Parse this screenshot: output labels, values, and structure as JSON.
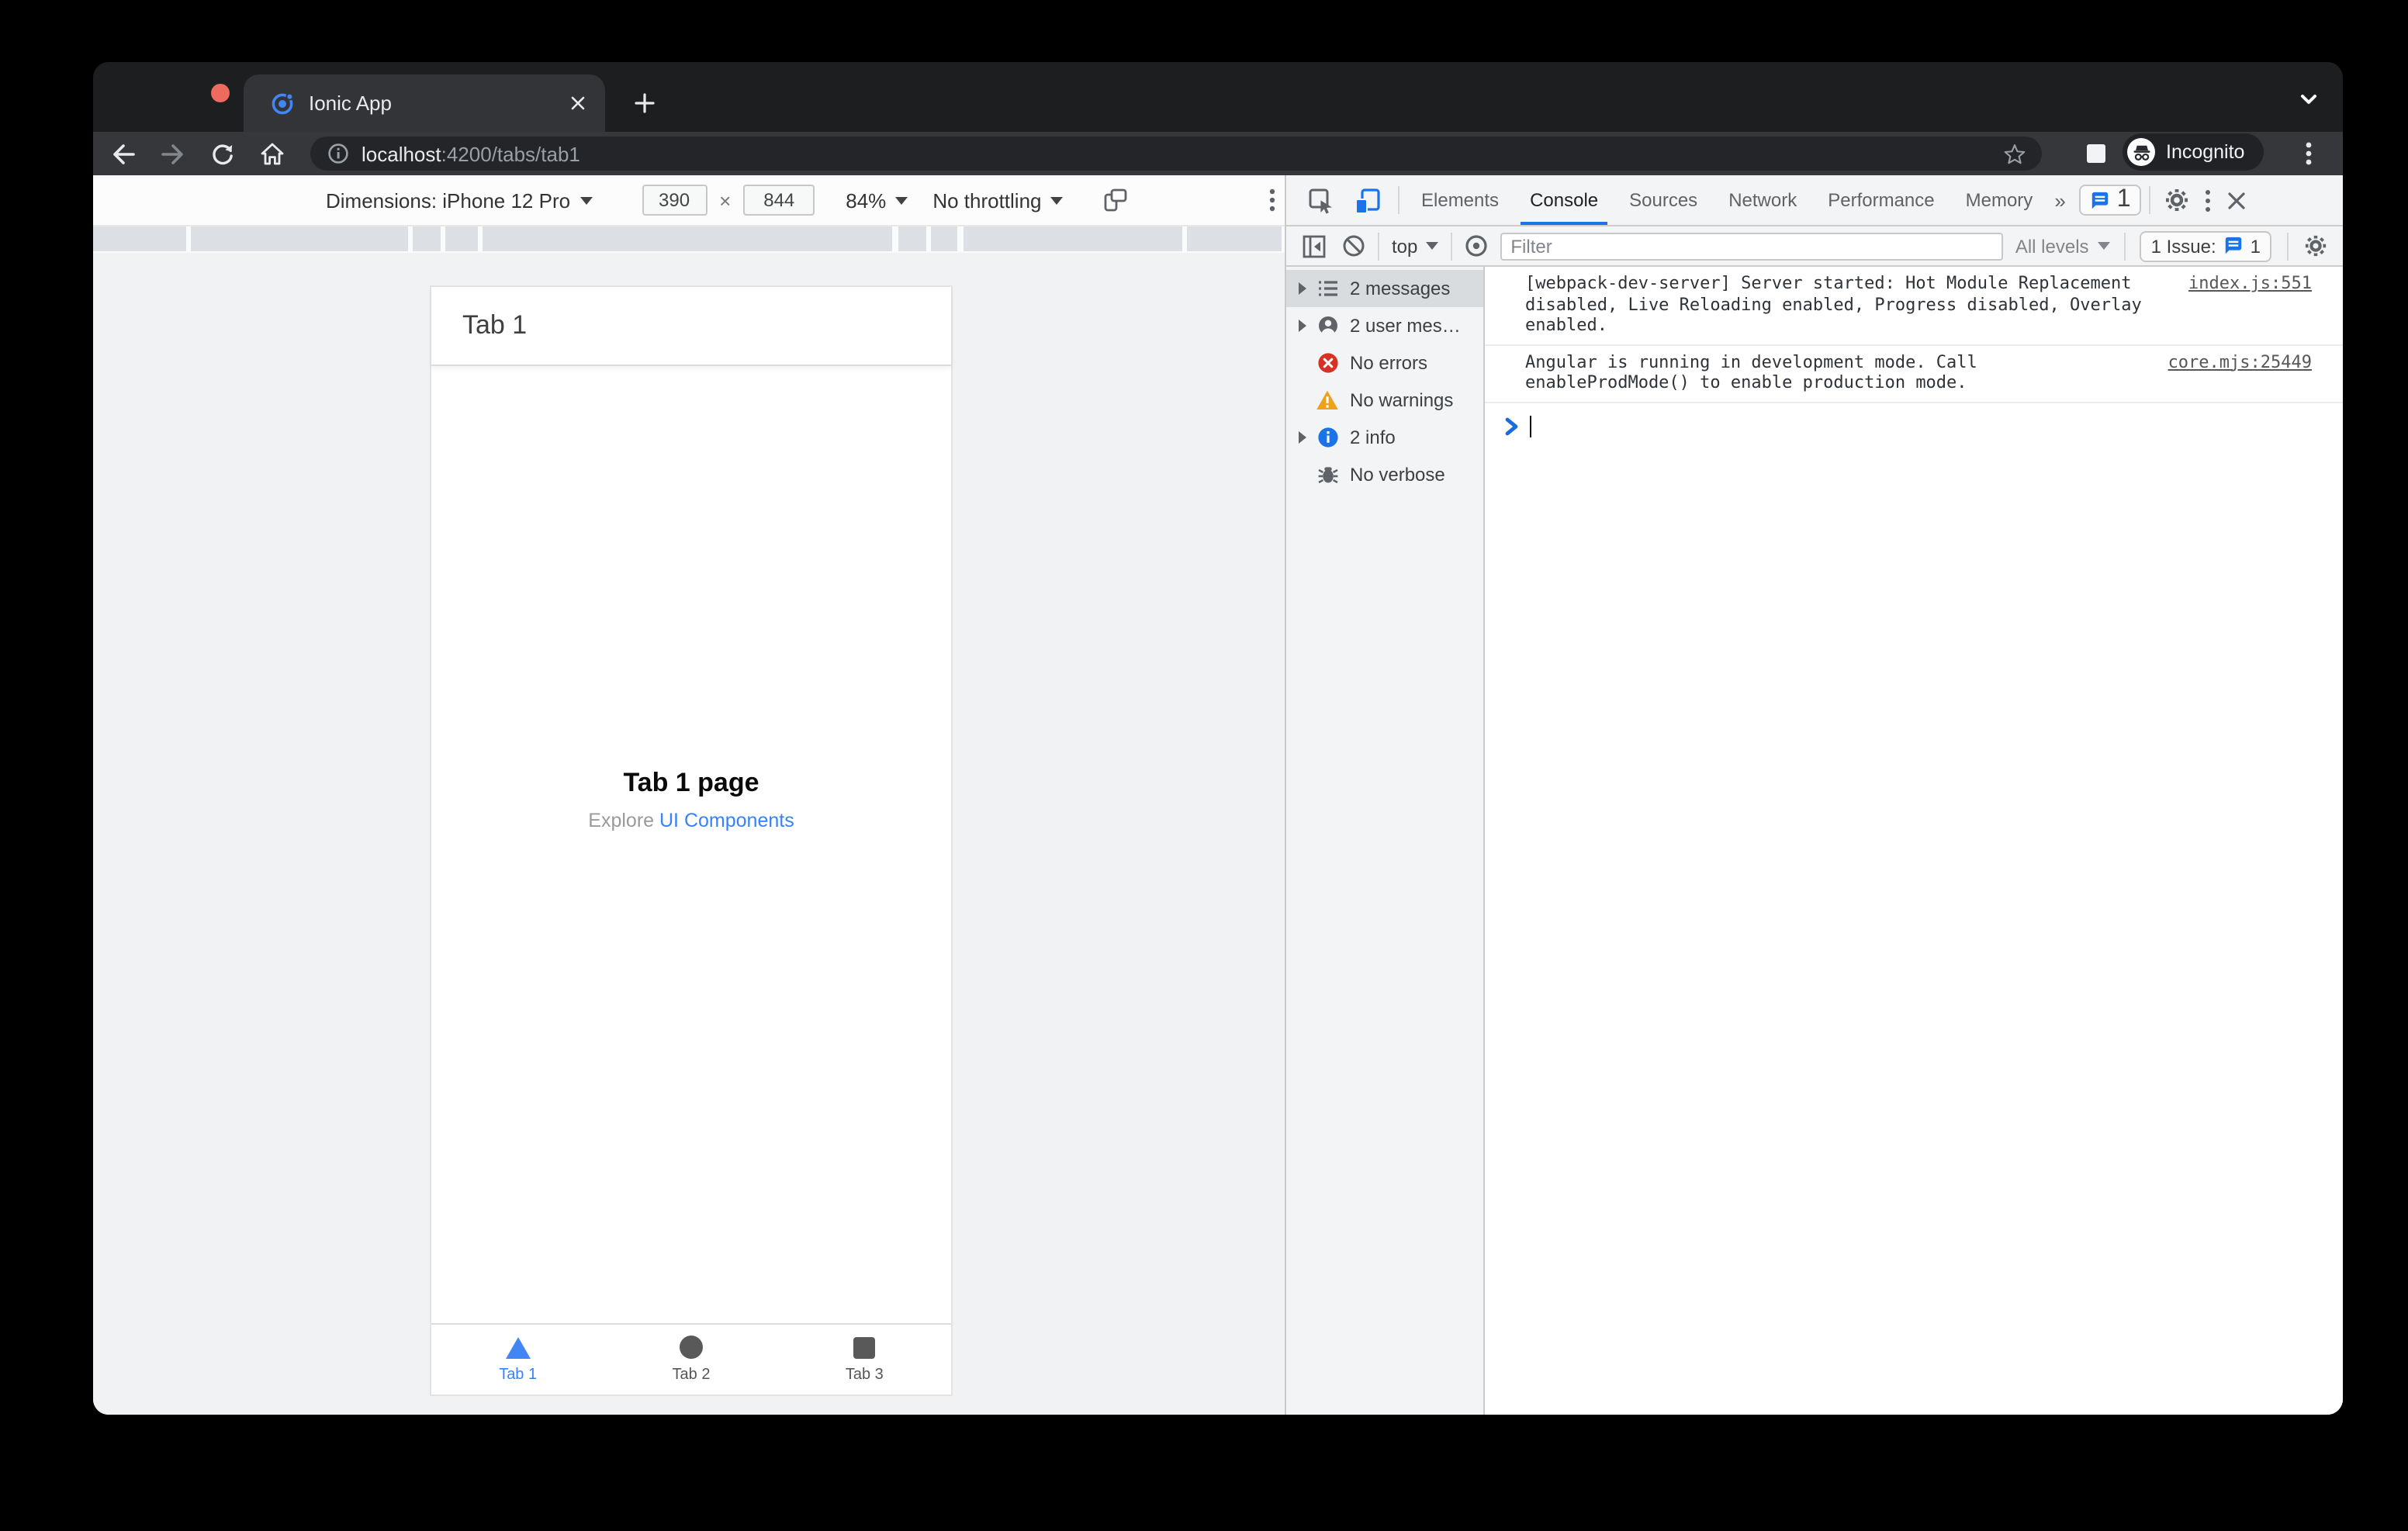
{
  "browser": {
    "tab_title": "Ionic App",
    "url": {
      "host": "localhost",
      "path": ":4200/tabs/tab1"
    },
    "incognito_label": "Incognito"
  },
  "device_toolbar": {
    "dimensions_label": "Dimensions: iPhone 12 Pro",
    "width_value": "390",
    "times": "×",
    "height_value": "844",
    "zoom_value": "84%",
    "throttling_value": "No throttling"
  },
  "app": {
    "header_title": "Tab 1",
    "page_title": "Tab 1 page",
    "explore_prefix": "Explore ",
    "explore_link": "UI Components",
    "tabs": [
      {
        "label": "Tab 1",
        "active": true
      },
      {
        "label": "Tab 2",
        "active": false
      },
      {
        "label": "Tab 3",
        "active": false
      }
    ]
  },
  "devtools": {
    "tabs": [
      "Elements",
      "Console",
      "Sources",
      "Network",
      "Performance",
      "Memory"
    ],
    "active_tab": "Console",
    "more_tabs_chevron": "»",
    "issues_count_top": "1",
    "console_toolbar": {
      "context_label": "top",
      "filter_placeholder": "Filter",
      "levels_label": "All levels",
      "issues_label": "1 Issue:",
      "issues_count": "1"
    },
    "sidebar": {
      "items": [
        {
          "label": "2 messages"
        },
        {
          "label": "2 user mes…"
        },
        {
          "label": "No errors"
        },
        {
          "label": "No warnings"
        },
        {
          "label": "2 info"
        },
        {
          "label": "No verbose"
        }
      ]
    },
    "console": {
      "messages": [
        {
          "lines": [
            "[webpack-dev-server] Server started: Hot Module Replacement",
            "disabled, Live Reloading enabled, Progress disabled, Overlay enabled."
          ],
          "source": "index.js:551"
        },
        {
          "lines": [
            "Angular is running in development mode. Call",
            "enableProdMode() to enable production mode."
          ],
          "source": "core.mjs:25449"
        }
      ]
    }
  },
  "colors": {
    "accent_blue": "#1a73e8",
    "ionic_blue": "#3880ff",
    "error_red": "#d93025",
    "warning_yellow": "#f0a11b"
  }
}
